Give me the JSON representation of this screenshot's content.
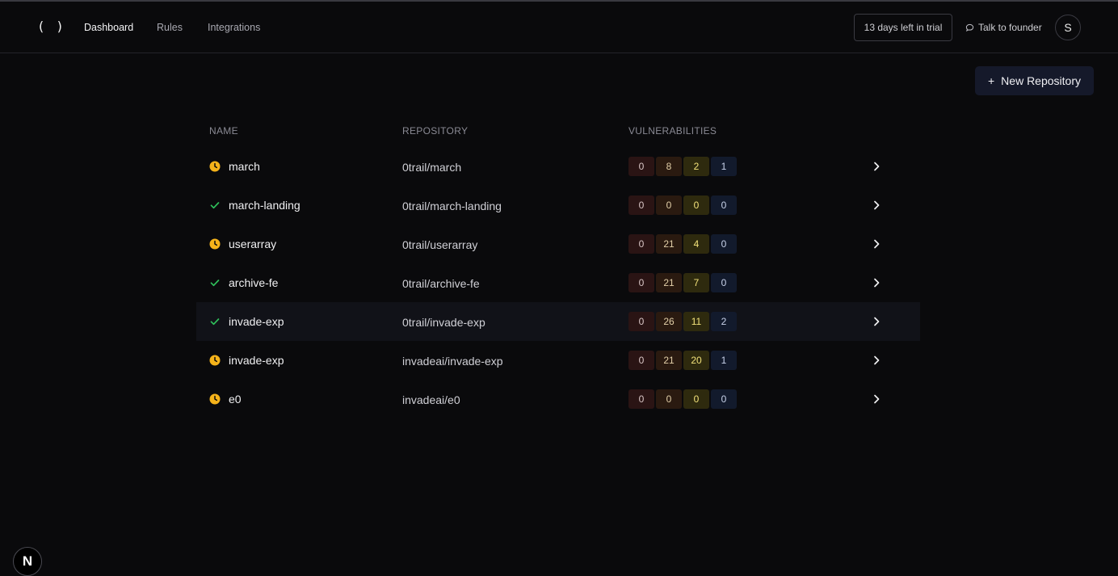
{
  "nav": {
    "logo": "( )",
    "links": [
      "Dashboard",
      "Rules",
      "Integrations"
    ],
    "trial": "13 days left in trial",
    "founder": "Talk to founder",
    "avatar": "S"
  },
  "actions": {
    "new_repo": "New Repository",
    "plus": "+"
  },
  "table": {
    "headers": [
      "NAME",
      "REPOSITORY",
      "VULNERABILITIES"
    ],
    "rows": [
      {
        "status": "pending",
        "name": "march",
        "repo": "0trail/march",
        "v": [
          "0",
          "8",
          "2",
          "1"
        ]
      },
      {
        "status": "done",
        "name": "march-landing",
        "repo": "0trail/march-landing",
        "v": [
          "0",
          "0",
          "0",
          "0"
        ]
      },
      {
        "status": "pending",
        "name": "userarray",
        "repo": "0trail/userarray",
        "v": [
          "0",
          "21",
          "4",
          "0"
        ]
      },
      {
        "status": "done",
        "name": "archive-fe",
        "repo": "0trail/archive-fe",
        "v": [
          "0",
          "21",
          "7",
          "0"
        ]
      },
      {
        "status": "done",
        "name": "invade-exp",
        "repo": "0trail/invade-exp",
        "v": [
          "0",
          "26",
          "11",
          "2"
        ]
      },
      {
        "status": "pending",
        "name": "invade-exp",
        "repo": "invadeai/invade-exp",
        "v": [
          "0",
          "21",
          "20",
          "1"
        ]
      },
      {
        "status": "pending",
        "name": "e0",
        "repo": "invadeai/e0",
        "v": [
          "0",
          "0",
          "0",
          "0"
        ]
      }
    ]
  },
  "badge": "N",
  "colors": {
    "pending": "#f5b31a",
    "done": "#2fbf5a",
    "background": "#0a0a0c"
  }
}
